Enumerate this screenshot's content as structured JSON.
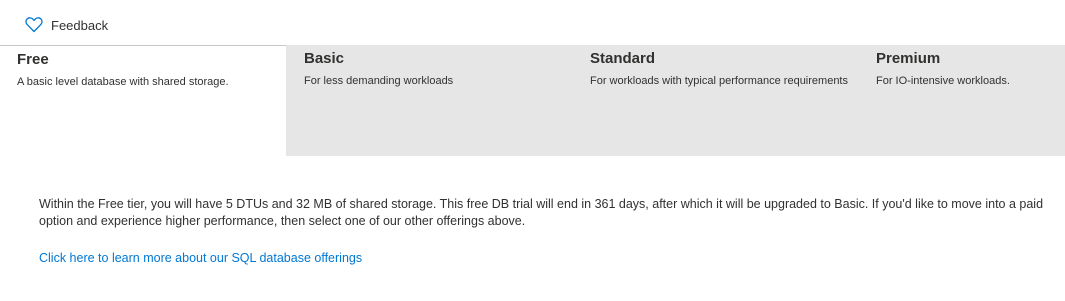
{
  "toolbar": {
    "feedback_label": "Feedback",
    "feedback_icon": "heart-outline-icon",
    "accent_color": "#0078d4"
  },
  "tiers": [
    {
      "name": "Free",
      "description": "A basic level database with shared storage.",
      "selected": true
    },
    {
      "name": "Basic",
      "description": "For less demanding workloads",
      "selected": false
    },
    {
      "name": "Standard",
      "description": "For workloads with typical performance requirements",
      "selected": false
    },
    {
      "name": "Premium",
      "description": "For IO-intensive workloads.",
      "selected": false
    }
  ],
  "info": {
    "text": "Within the Free tier, you will have 5 DTUs and 32 MB of shared storage. This free DB trial will end in 361 days, after which it will be upgraded to Basic. If you'd like to move into a paid option and experience higher performance, then select one of our other offerings above.",
    "link_text": "Click here to learn more about our SQL database offerings"
  }
}
